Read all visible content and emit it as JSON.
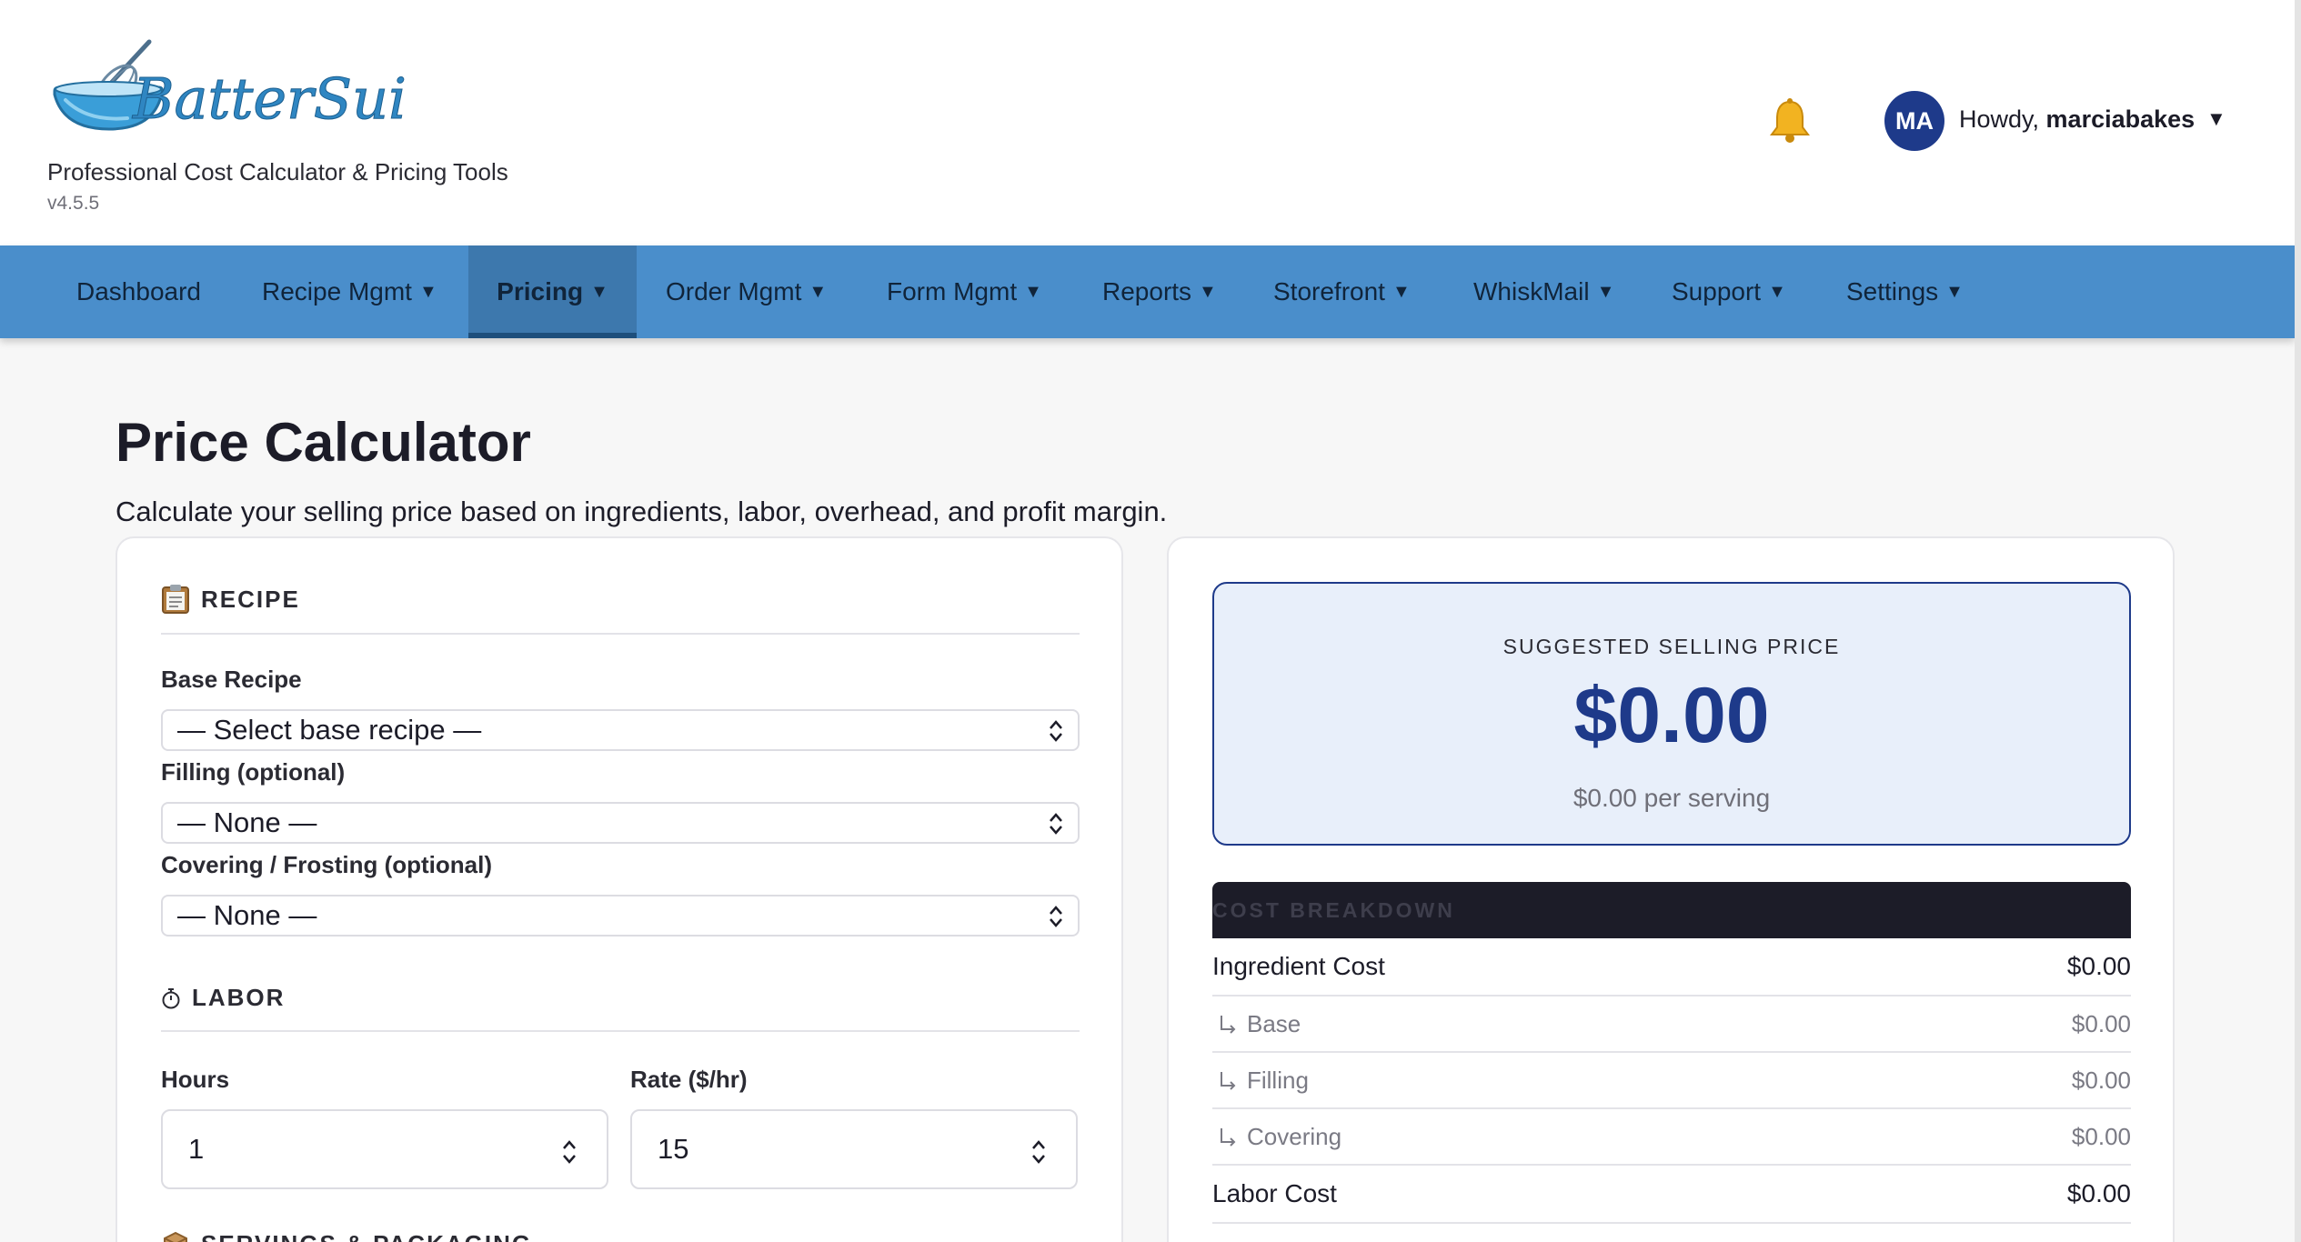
{
  "app": {
    "logo_text": "BatterSuite",
    "tagline": "Professional Cost Calculator & Pricing Tools",
    "version": "v4.5.5"
  },
  "user": {
    "initials": "MA",
    "greeting": "Howdy,",
    "username": "marciabakes"
  },
  "nav": {
    "items": [
      {
        "label": "Dashboard"
      },
      {
        "label": "Recipe Mgmt"
      },
      {
        "label": "Pricing"
      },
      {
        "label": "Order Mgmt"
      },
      {
        "label": "Form Mgmt"
      },
      {
        "label": "Reports"
      },
      {
        "label": "Storefront"
      },
      {
        "label": "WhiskMail"
      },
      {
        "label": "Support"
      },
      {
        "label": "Settings"
      }
    ],
    "active": "Pricing"
  },
  "page": {
    "title": "Price Calculator",
    "subtitle": "Calculate your selling price based on ingredients, labor, overhead, and profit margin."
  },
  "recipe": {
    "heading": "RECIPE",
    "base_label": "Base Recipe",
    "base_value": "— Select base recipe —",
    "filling_label": "Filling (optional)",
    "filling_value": "— None —",
    "covering_label": "Covering / Frosting (optional)",
    "covering_value": "— None —"
  },
  "labor": {
    "heading": "LABOR",
    "hours_label": "Hours",
    "hours_value": "1",
    "rate_label": "Rate ($/hr)",
    "rate_value": "15"
  },
  "servings": {
    "heading": "SERVINGS & PACKAGING"
  },
  "result": {
    "label": "SUGGESTED SELLING PRICE",
    "price": "$0.00",
    "per_serving": "$0.00 per serving"
  },
  "breakdown": {
    "heading": "COST BREAKDOWN",
    "rows": [
      {
        "label": "Ingredient Cost",
        "value": "$0.00"
      },
      {
        "label": "Base",
        "value": "$0.00"
      },
      {
        "label": "Filling",
        "value": "$0.00"
      },
      {
        "label": "Covering",
        "value": "$0.00"
      },
      {
        "label": "Labor Cost",
        "value": "$0.00"
      }
    ]
  },
  "colors": {
    "nav_bg": "#4a8ecb",
    "accent": "#1e3a8a",
    "price_bg": "#e8effa"
  }
}
